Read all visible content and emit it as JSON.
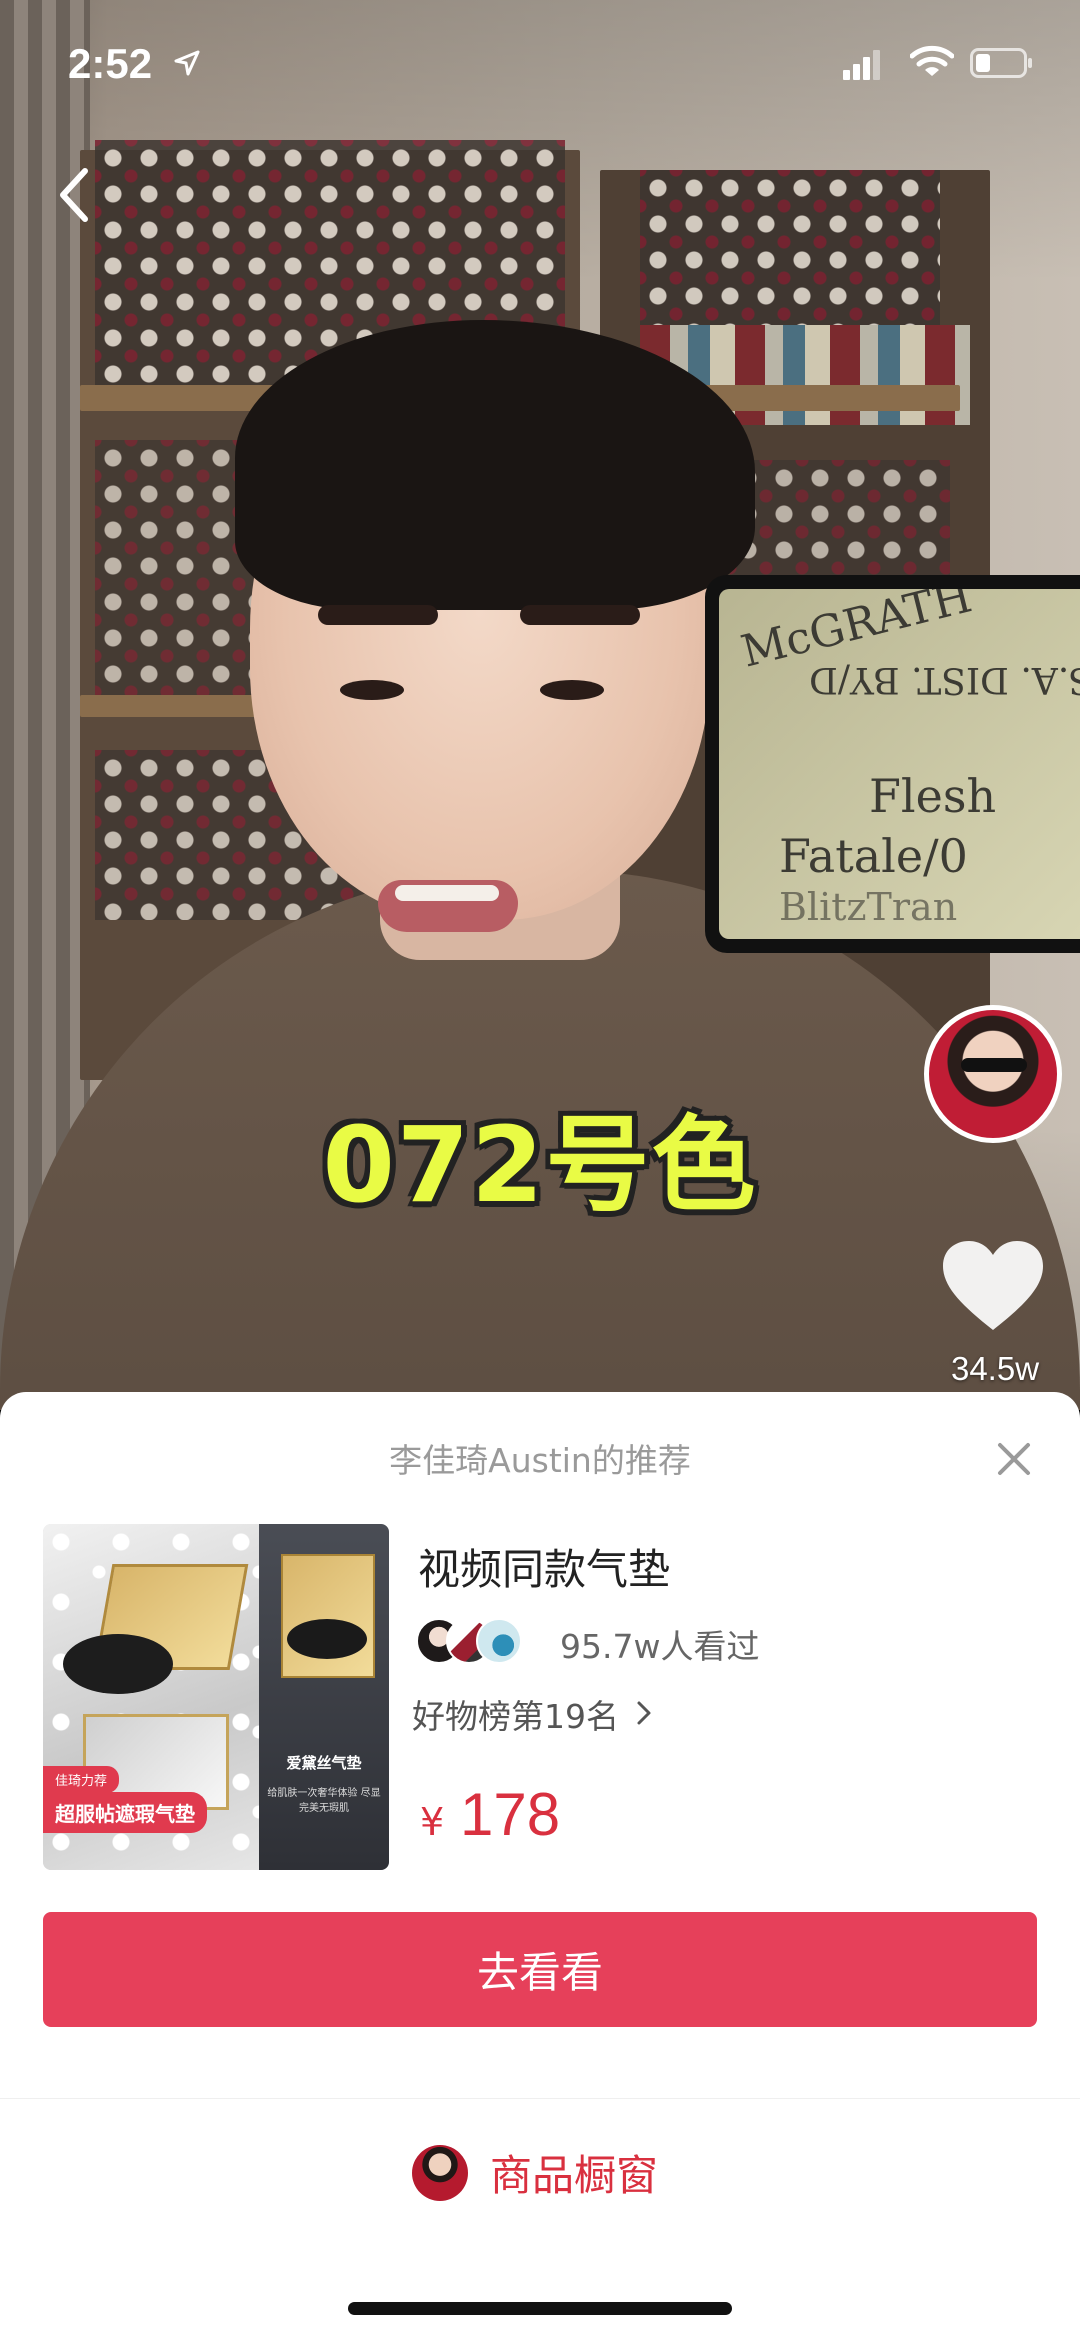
{
  "status_bar": {
    "time": "2:52"
  },
  "video": {
    "caption": "072号色",
    "tablet_lines": [
      "McGRATH",
      "S.A. DIST. BY/D",
      "Flesh",
      "Fatale/0",
      "BlitzTran"
    ],
    "like_count": "34.5w"
  },
  "sheet": {
    "title": "李佳琦Austin的推荐",
    "product": {
      "image_badge_small": "佳琦力荐",
      "image_badge_large": "超服帖遮瑕气垫",
      "image_right_title": "爱黛丝气垫",
      "image_right_sub": "给肌肤一次奢华体验 尽显完美无瑕肌",
      "name": "视频同款气垫",
      "viewers": "95.7w人看过",
      "rank": "好物榜第19名",
      "currency": "¥",
      "price": "178"
    },
    "go_button": "去看看",
    "showcase_label": "商品橱窗"
  },
  "colors": {
    "accent": "#e6405a",
    "price": "#d9303f",
    "caption": "#e9fb45"
  }
}
